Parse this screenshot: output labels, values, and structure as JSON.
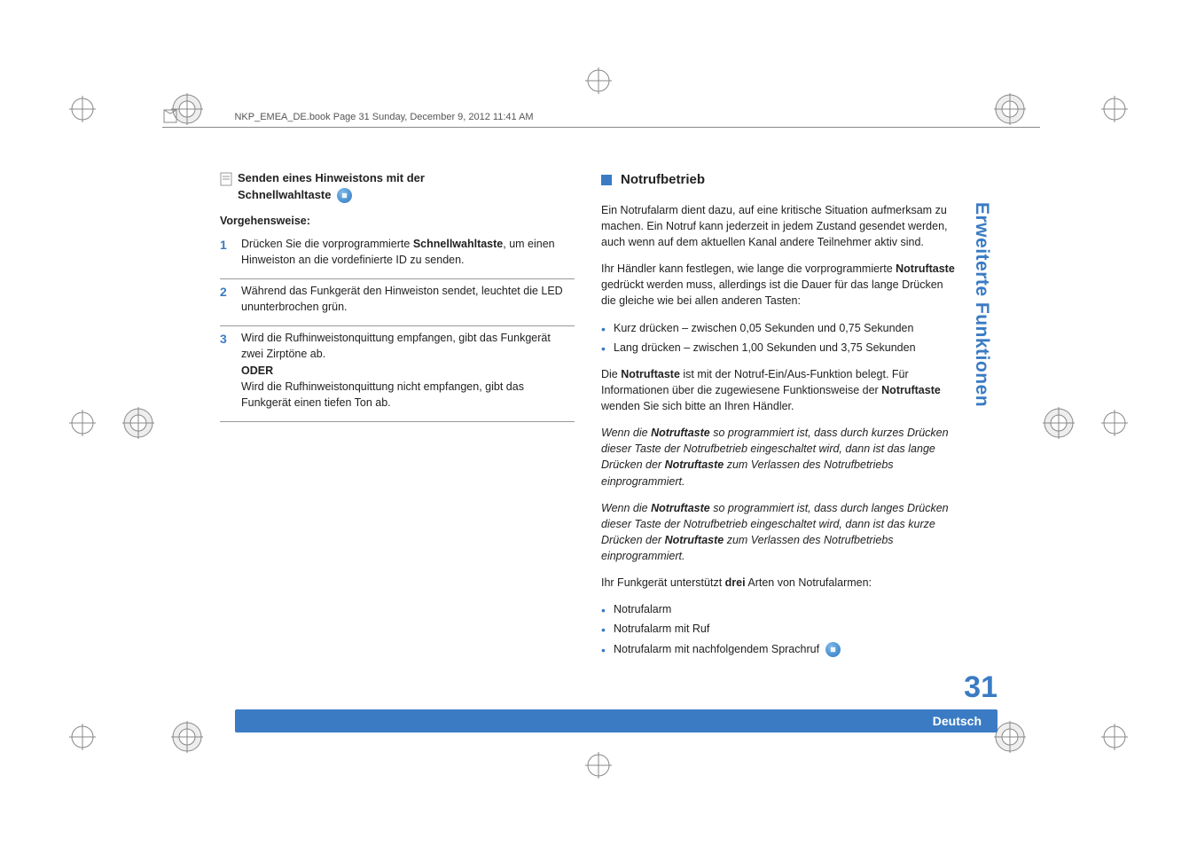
{
  "header": {
    "text": "NKP_EMEA_DE.book  Page 31  Sunday, December 9, 2012  11:41 AM"
  },
  "left": {
    "title_line1": "Senden eines Hinweistons mit der",
    "title_line2": "Schnellwahltaste",
    "procedure_label": "Vorgehensweise:",
    "steps": [
      {
        "num": "1",
        "text_a": "Drücken Sie die vorprogrammierte ",
        "bold": "Schnellwahltaste",
        "text_b": ", um einen Hinweiston an die vordefinierte ID zu senden."
      },
      {
        "num": "2",
        "text_a": "Während das Funkgerät den Hinweiston sendet, leuchtet die LED ununterbrochen grün.",
        "bold": "",
        "text_b": ""
      },
      {
        "num": "3",
        "text_a": "Wird die Rufhinweistonquittung empfangen, gibt das Funkgerät zwei Zirptöne ab.",
        "bold": "",
        "text_b": "",
        "oder": "ODER",
        "extra": "Wird die Rufhinweistonquittung nicht empfangen, gibt das Funkgerät einen tiefen Ton ab."
      }
    ]
  },
  "right": {
    "title": "Notrufbetrieb",
    "p1": "Ein Notrufalarm dient dazu, auf eine kritische Situation aufmerksam zu machen. Ein Notruf kann jederzeit in jedem Zustand gesendet werden, auch wenn auf dem aktuellen Kanal andere Teilnehmer aktiv sind.",
    "p2_a": "Ihr Händler kann festlegen, wie lange die vorprogrammierte ",
    "p2_bold": "Notruftaste",
    "p2_b": " gedrückt werden muss, allerdings ist die Dauer für das lange Drücken die gleiche wie bei allen anderen Tasten:",
    "press_list": [
      "Kurz drücken – zwischen 0,05 Sekunden und 0,75 Sekunden",
      "Lang drücken – zwischen 1,00 Sekunden und 3,75 Sekunden"
    ],
    "p3_a": "Die ",
    "p3_bold1": "Notruftaste",
    "p3_b": " ist mit der Notruf-Ein/Aus-Funktion belegt. Für Informationen über die zugewiesene Funktionsweise der ",
    "p3_bold2": "Notruftaste",
    "p3_c": " wenden Sie sich bitte an Ihren Händler.",
    "it1_a": "Wenn die ",
    "it1_bold1": "Notruftaste",
    "it1_b": " so programmiert ist, dass durch kurzes Drücken dieser Taste der Notrufbetrieb eingeschaltet wird, dann ist das lange Drücken der ",
    "it1_bold2": "Notruftaste",
    "it1_c": " zum Verlassen des Notrufbetriebs einprogrammiert.",
    "it2_a": "Wenn die ",
    "it2_bold1": "Notruftaste",
    "it2_b": " so programmiert ist, dass durch langes Drücken dieser Taste der Notrufbetrieb eingeschaltet wird, dann ist das kurze Drücken der ",
    "it2_bold2": "Notruftaste",
    "it2_c": " zum Verlassen des Notrufbetriebs einprogrammiert.",
    "p4_a": "Ihr Funkgerät unterstützt ",
    "p4_bold": "drei",
    "p4_b": " Arten von Notrufalarmen:",
    "alarm_list": [
      "Notrufalarm",
      "Notrufalarm mit Ruf",
      "Notrufalarm mit nachfolgendem Sprachruf"
    ]
  },
  "sidebar": {
    "text": "Erweiterte Funktionen",
    "page_number": "31",
    "language": "Deutsch"
  }
}
